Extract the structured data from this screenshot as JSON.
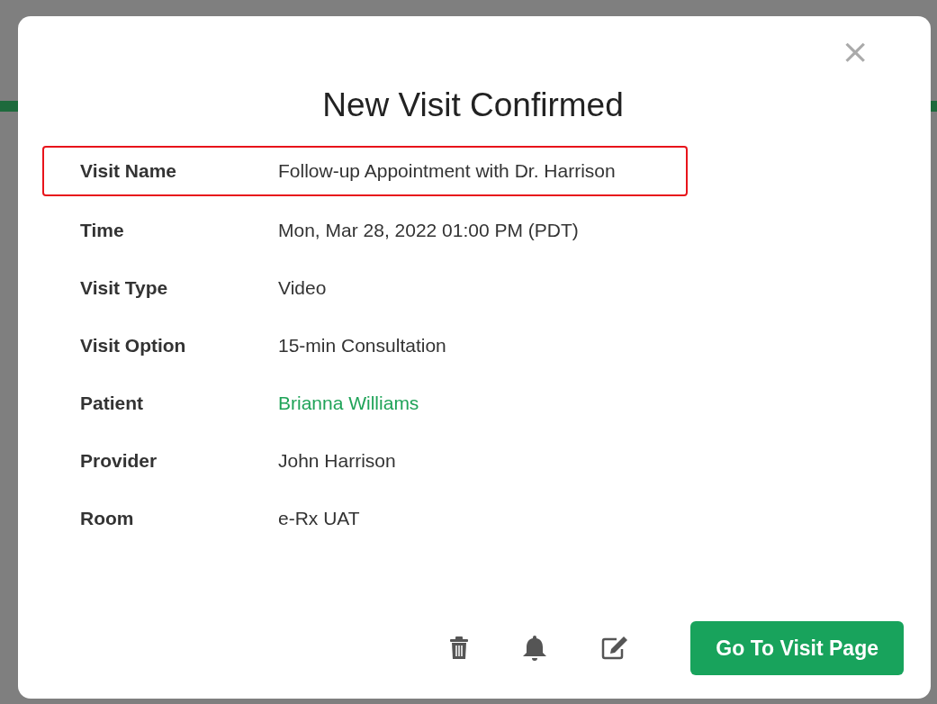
{
  "dialog": {
    "title": "New Visit Confirmed",
    "close": "×"
  },
  "details": [
    {
      "label": "Visit Name",
      "value": "Follow-up Appointment with Dr. Harrison",
      "kind": "text",
      "highlighted": true
    },
    {
      "label": "Time",
      "value": "Mon, Mar 28, 2022 01:00 PM (PDT)",
      "kind": "text",
      "highlighted": false
    },
    {
      "label": "Visit Type",
      "value": "Video",
      "kind": "text",
      "highlighted": false
    },
    {
      "label": "Visit Option",
      "value": "15-min Consultation",
      "kind": "text",
      "highlighted": false
    },
    {
      "label": "Patient",
      "value": "Brianna Williams",
      "kind": "link",
      "highlighted": false
    },
    {
      "label": "Provider",
      "value": "John Harrison",
      "kind": "text",
      "highlighted": false
    },
    {
      "label": "Room",
      "value": "e-Rx UAT",
      "kind": "text",
      "highlighted": false
    }
  ],
  "actions": {
    "primary": "Go To Visit Page"
  }
}
